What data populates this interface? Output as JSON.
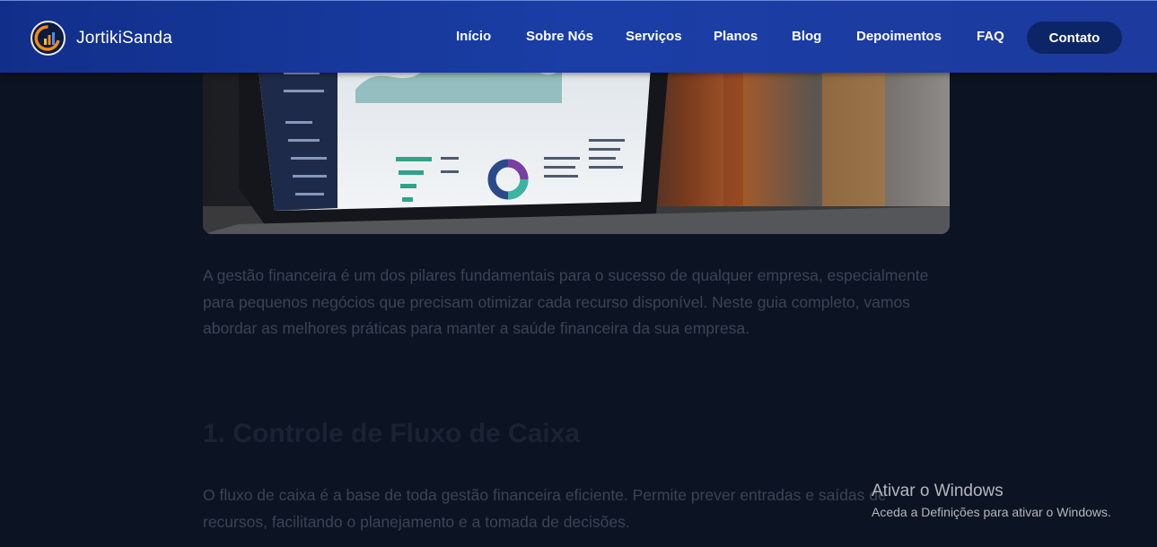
{
  "header": {
    "brand_name": "JortikiSanda",
    "logo_icon": "chart-logo-icon",
    "nav": [
      {
        "label": "Início"
      },
      {
        "label": "Sobre Nós"
      },
      {
        "label": "Serviços"
      },
      {
        "label": "Planos"
      },
      {
        "label": "Blog"
      },
      {
        "label": "Depoimentos"
      },
      {
        "label": "FAQ"
      }
    ],
    "cta_label": "Contato"
  },
  "article": {
    "intro": "A gestão financeira é um dos pilares fundamentais para o sucesso de qualquer empresa, especialmente para pequenos negócios que precisam otimizar cada recurso disponível. Neste guia completo, vamos abordar as melhores práticas para manter a saúde financeira da sua empresa.",
    "section_title": "1. Controle de Fluxo de Caixa",
    "section_text": "O fluxo de caixa é a base de toda gestão financeira eficiente. Permite prever entradas e saídas de recursos, facilitando o planejamento e a tomada de decisões."
  },
  "os_watermark": {
    "title": "Ativar o Windows",
    "subtitle": "Aceda a Definições para ativar o Windows."
  },
  "colors": {
    "navbar": "#1a3ea6",
    "cta": "#0c2566",
    "page_bg": "#0c1322"
  }
}
